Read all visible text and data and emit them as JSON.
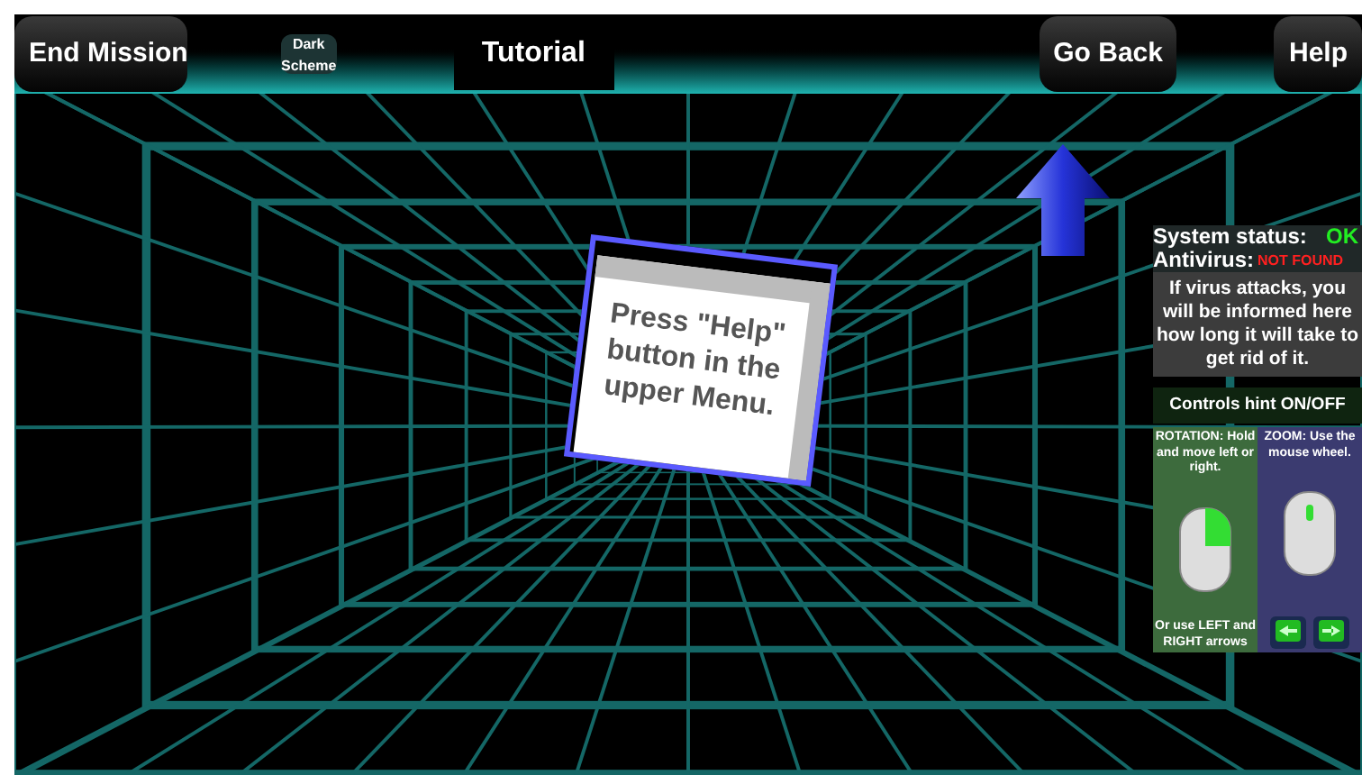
{
  "top_bar": {
    "end_button": "End Mission",
    "scheme_dropdown": "Dark Scheme",
    "title": "Tutorial",
    "back_button": "Go Back",
    "help_button": "Help"
  },
  "card": {
    "text": "Press \"Help\" button in the upper Menu."
  },
  "status_panel": {
    "system_label": "System status:",
    "system_value": "OK",
    "antivirus_label": "Antivirus:",
    "antivirus_value": "NOT FOUND",
    "info": "If virus attacks, you will be informed here how long it will take to get rid of it.",
    "controls_toggle": "Controls hint ON/OFF",
    "rotation_hint": "ROTATION: Hold and move left or right.",
    "zoom_hint": "ZOOM: Use the mouse wheel.",
    "arrows_hint": "Or use LEFT and RIGHT arrows"
  }
}
